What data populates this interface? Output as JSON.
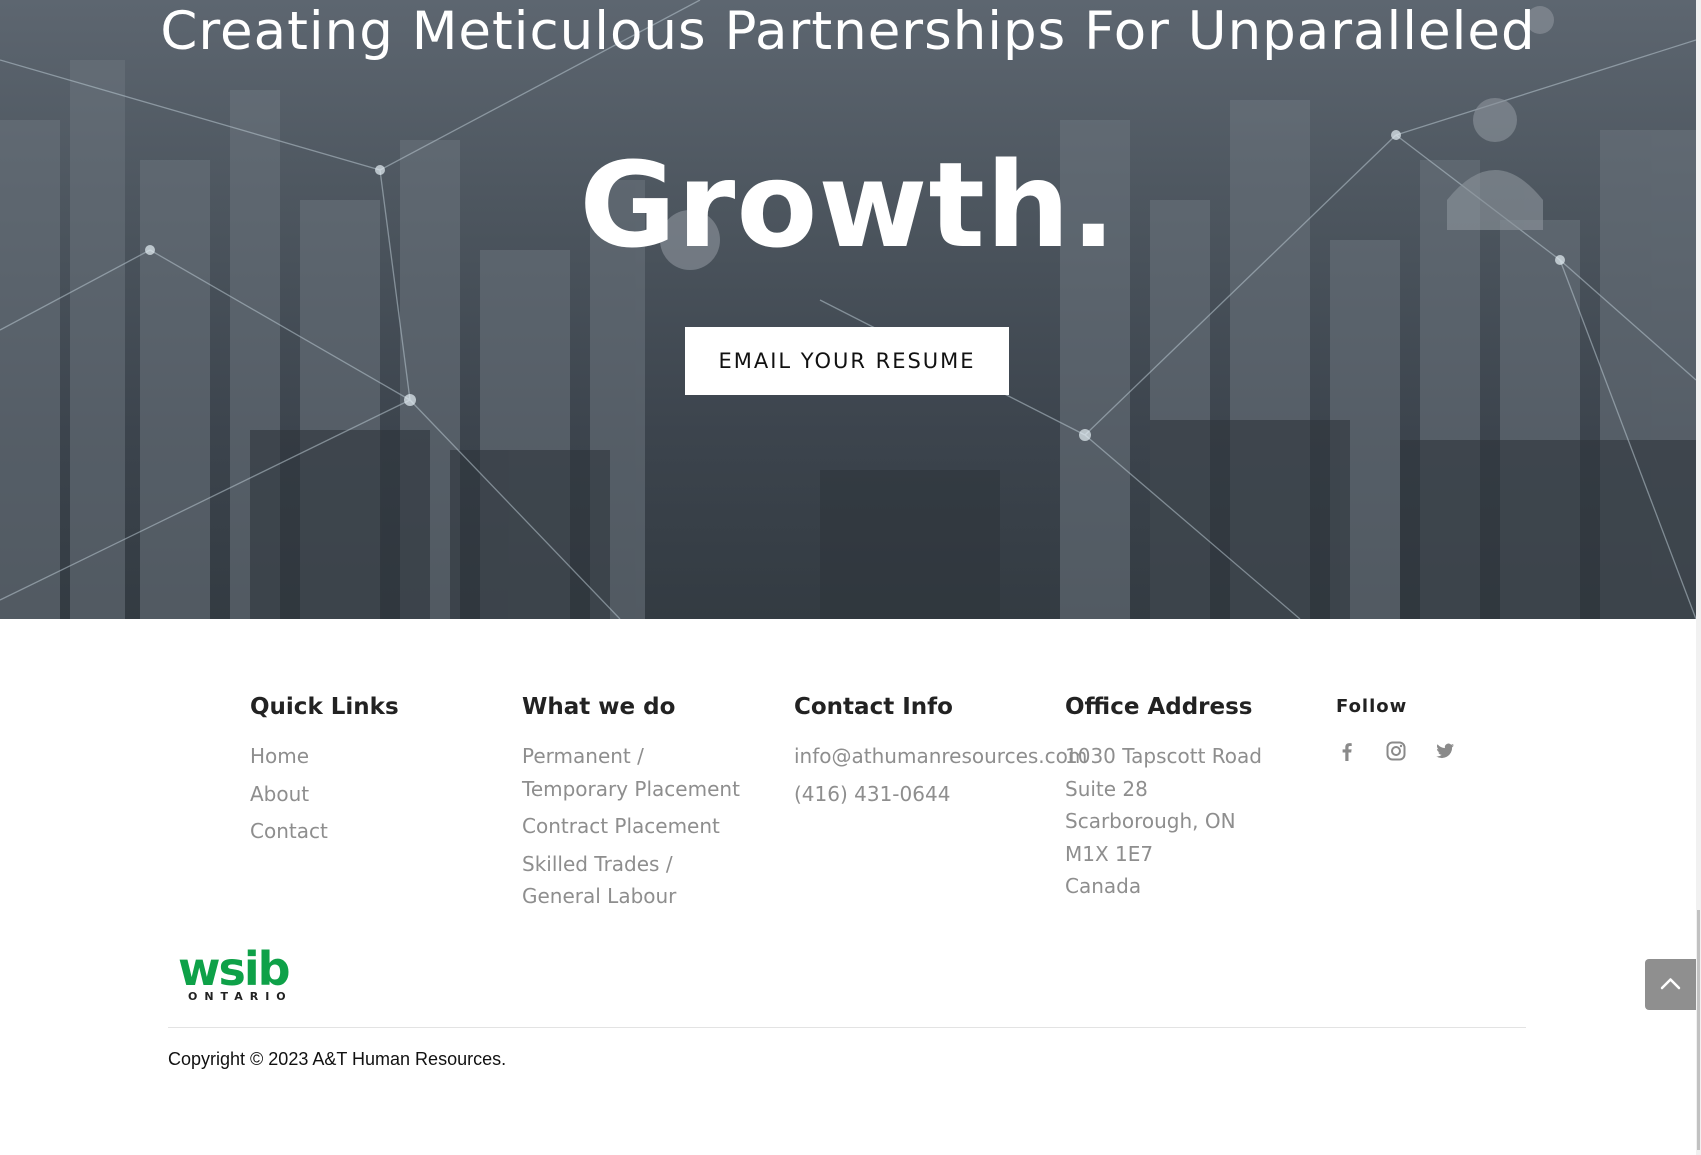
{
  "hero": {
    "headline": "Creating Meticulous Partnerships For Unparalleled",
    "emphasis": "Growth.",
    "cta_label": "EMAIL YOUR RESUME"
  },
  "footer": {
    "quick_links": {
      "title": "Quick Links",
      "items": [
        "Home",
        "About",
        "Contact"
      ]
    },
    "what_we_do": {
      "title": "What we do",
      "items": [
        "Permanent /\nTemporary Placement",
        "Contract Placement",
        "Skilled Trades /\nGeneral Labour"
      ]
    },
    "contact_info": {
      "title": "Contact Info",
      "email": "info@athumanresources.com",
      "phone": "(416) 431-0644"
    },
    "office_address": {
      "title": "Office Address",
      "lines": [
        "1030 Tapscott Road",
        "Suite 28",
        "Scarborough, ON",
        "M1X 1E7",
        "Canada"
      ]
    },
    "follow": {
      "title": "Follow",
      "icons": [
        "facebook-icon",
        "instagram-icon",
        "twitter-icon"
      ]
    },
    "badge": {
      "brand": "wsib",
      "region": "ONTARIO",
      "color": "#0ea148"
    },
    "copyright": "Copyright © 2023 A&T Human Resources."
  },
  "colors": {
    "link_gray": "#8e8e8e",
    "heading_dark": "#222222",
    "back_to_top_bg": "#8f8f8f"
  }
}
